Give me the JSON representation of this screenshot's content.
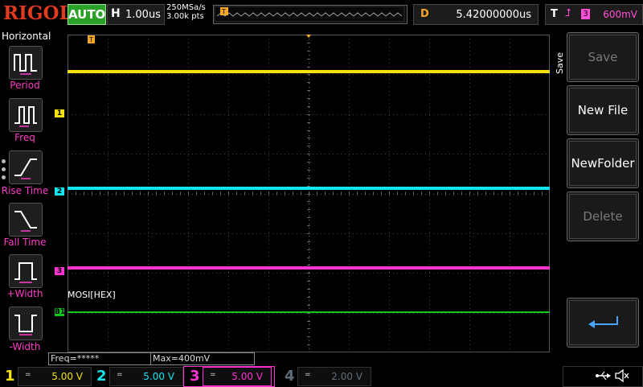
{
  "topbar": {
    "logo": "RIGOL",
    "run_status": "AUTO",
    "horizontal_label": "H",
    "timebase": "1.00us",
    "sample_rate": "250MSa/s",
    "memory_depth": "3.00k pts",
    "delay_label": "D",
    "delay_value": "5.42000000us",
    "trigger_label": "T",
    "trigger_channel": "3",
    "trigger_level": "600mV",
    "trigger_marker": "T"
  },
  "left_panel": {
    "title": "Horizontal",
    "items": [
      {
        "label": "Period",
        "icon": "period-icon"
      },
      {
        "label": "Freq",
        "icon": "freq-icon"
      },
      {
        "label": "Rise Time",
        "icon": "rise-time-icon"
      },
      {
        "label": "Fall Time",
        "icon": "fall-time-icon"
      },
      {
        "label": "+Width",
        "icon": "pos-width-icon"
      },
      {
        "label": "-Width",
        "icon": "neg-width-icon"
      }
    ]
  },
  "channels_markers": {
    "ch1": "1",
    "ch2": "2",
    "ch3": "3",
    "bus": "B1",
    "trigger_level_marker": "T"
  },
  "bus_label": "MOSI[HEX]",
  "right_panel": {
    "tab": "Save",
    "buttons": [
      {
        "label": "Save",
        "enabled": false
      },
      {
        "label": "New File",
        "enabled": true
      },
      {
        "label": "NewFolder",
        "enabled": true
      },
      {
        "label": "Delete",
        "enabled": false
      },
      {
        "label": "",
        "icon": "return-icon",
        "enabled": true
      }
    ]
  },
  "measurements": {
    "freq": "Freq=*****",
    "max": "Max=400mV"
  },
  "bottom_channels": [
    {
      "num": "1",
      "coupling": "=",
      "scale": "5.00 V",
      "color": "#f5e10f"
    },
    {
      "num": "2",
      "coupling": "=",
      "scale": "5.00 V",
      "color": "#12e4f0"
    },
    {
      "num": "3",
      "coupling": "=",
      "scale": "5.00 V",
      "color": "#ff32d2"
    },
    {
      "num": "4",
      "coupling": "=",
      "scale": "2.00 V",
      "color": "#5f6d7a"
    }
  ],
  "colors": {
    "ch1": "#f5e10f",
    "ch2": "#12e4f0",
    "ch3": "#ff32d2",
    "bus": "#12c818",
    "trigger": "#f5a623"
  },
  "status_icons": [
    "usb-icon",
    "speaker-muted-icon"
  ]
}
